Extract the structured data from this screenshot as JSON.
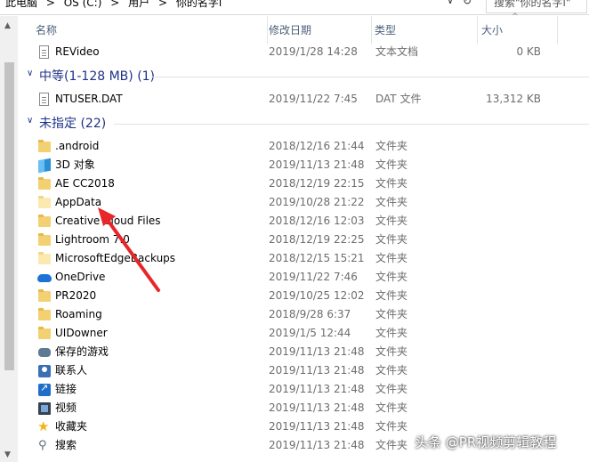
{
  "address": {
    "segments": [
      "此电脑",
      ">",
      "OS (C:)",
      ">",
      "用户",
      ">",
      "你的名字i"
    ],
    "search_placeholder": "搜索\"你的名字i\""
  },
  "columns": {
    "name": "名称",
    "date": "修改日期",
    "type": "类型",
    "size": "大小"
  },
  "top_row": {
    "name": "REVideo",
    "date": "2019/1/28 14:28",
    "type": "文本文档",
    "size": "0 KB",
    "icon": "text-document-icon"
  },
  "groups": [
    {
      "title": "中等(1-128 MB)  (1)",
      "items": [
        {
          "name": "NTUSER.DAT",
          "date": "2019/11/22 7:45",
          "type": "DAT 文件",
          "size": "13,312 KB",
          "icon": "file-icon"
        }
      ]
    },
    {
      "title": "未指定 (22)",
      "items": [
        {
          "name": ".android",
          "date": "2018/12/16 21:44",
          "type": "文件夹",
          "icon": "folder-icon"
        },
        {
          "name": "3D 对象",
          "date": "2019/11/13 21:48",
          "type": "文件夹",
          "icon": "3d-objects-icon"
        },
        {
          "name": "AE CC2018",
          "date": "2018/12/19 22:15",
          "type": "文件夹",
          "icon": "folder-icon"
        },
        {
          "name": "AppData",
          "date": "2019/10/28 21:22",
          "type": "文件夹",
          "icon": "hidden-folder-icon"
        },
        {
          "name": "Creative Cloud Files",
          "date": "2018/12/16 12:03",
          "type": "文件夹",
          "icon": "folder-icon"
        },
        {
          "name": "Lightroom 7.0",
          "date": "2018/12/19 22:25",
          "type": "文件夹",
          "icon": "folder-icon"
        },
        {
          "name": "MicrosoftEdgeBackups",
          "date": "2018/12/15 15:21",
          "type": "文件夹",
          "icon": "hidden-folder-icon"
        },
        {
          "name": "OneDrive",
          "date": "2019/11/22 7:46",
          "type": "文件夹",
          "icon": "onedrive-icon"
        },
        {
          "name": "PR2020",
          "date": "2019/10/25 12:02",
          "type": "文件夹",
          "icon": "folder-icon"
        },
        {
          "name": "Roaming",
          "date": "2018/9/28 6:37",
          "type": "文件夹",
          "icon": "folder-icon"
        },
        {
          "name": "UIDowner",
          "date": "2019/1/5 12:44",
          "type": "文件夹",
          "icon": "folder-icon"
        },
        {
          "name": "保存的游戏",
          "date": "2019/11/13 21:48",
          "type": "文件夹",
          "icon": "saved-games-icon"
        },
        {
          "name": "联系人",
          "date": "2019/11/13 21:48",
          "type": "文件夹",
          "icon": "contacts-icon"
        },
        {
          "name": "链接",
          "date": "2019/11/13 21:48",
          "type": "文件夹",
          "icon": "links-icon"
        },
        {
          "name": "视频",
          "date": "2019/11/13 21:48",
          "type": "文件夹",
          "icon": "videos-icon"
        },
        {
          "name": "收藏夹",
          "date": "2019/11/13 21:48",
          "type": "文件夹",
          "icon": "favorites-icon"
        },
        {
          "name": "搜索",
          "date": "2019/11/13 21:48",
          "type": "文件夹",
          "icon": "searches-icon"
        }
      ]
    }
  ],
  "watermark": "头条 @PR视频剪辑教程",
  "colors": {
    "group_title": "#1e3287",
    "annotation_arrow": "#e8262a",
    "muted_text": "#6d6d6d"
  }
}
